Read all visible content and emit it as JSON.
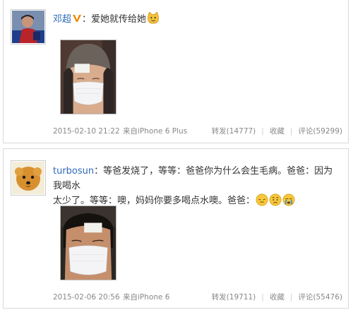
{
  "posts": [
    {
      "author": "邓超",
      "text": "：爱她就传给她",
      "emoji": [
        "cat-face-emoji"
      ],
      "time": "2015-02-10 21:22",
      "via": "来自iPhone 6 Plus",
      "repost": "转发(14777)",
      "favorite": "收藏",
      "comment": "评论(59299)"
    },
    {
      "author": "turbosun",
      "text_line1": "：等爸发烧了，等等：爸爸你为什么会生毛病。爸爸：因为我喝水",
      "text_line2": "太少了。等等：噢，妈妈你要多喝点水噢。爸爸：",
      "emoji": [
        "pensive-face-emoji",
        "worried-face-emoji",
        "crying-face-emoji"
      ],
      "time": "2015-02-06 20:56",
      "via": "来自iPhone 6",
      "repost": "转发(19711)",
      "favorite": "收藏",
      "comment": "评论(55476)"
    }
  ],
  "colors": {
    "author": "#2e6bb8",
    "verified": "#f08a00",
    "meta": "#888888",
    "border": "#d9d9d9"
  }
}
